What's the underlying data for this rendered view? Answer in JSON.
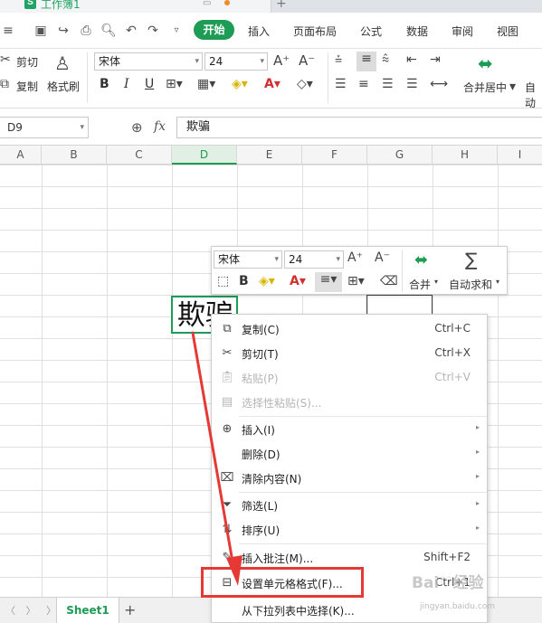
{
  "title_tabs": {
    "doc_name": "工作簿1",
    "app_icon": "S",
    "new_tab": "+"
  },
  "menu": {
    "start": "开始",
    "items": [
      "插入",
      "页面布局",
      "公式",
      "数据",
      "审阅",
      "视图"
    ]
  },
  "ribbon": {
    "cut": "剪切",
    "copy": "复制",
    "format_painter": "格式刷",
    "font_name": "宋体",
    "font_size": "24",
    "bold": "B",
    "italic": "I",
    "underline": "U",
    "merge_center": "合并居中",
    "auto_wrap": "自动"
  },
  "formula_bar": {
    "name_box": "D9",
    "fx": "fx",
    "content": "欺骗"
  },
  "columns": [
    "A",
    "B",
    "C",
    "D",
    "E",
    "F",
    "G",
    "H",
    "I"
  ],
  "selected_column": "D",
  "active_cell_value": "欺骗",
  "mini_toolbar": {
    "font_name": "宋体",
    "font_size": "24",
    "bold": "B",
    "merge": "合并",
    "autosum": "自动求和",
    "sigma": "∑"
  },
  "context_menu": [
    {
      "icon": "copy-icon",
      "label": "复制(C)",
      "shortcut": "Ctrl+C",
      "enabled": true
    },
    {
      "icon": "scissors-icon",
      "label": "剪切(T)",
      "shortcut": "Ctrl+X",
      "enabled": true
    },
    {
      "icon": "paste-icon",
      "label": "粘贴(P)",
      "shortcut": "Ctrl+V",
      "enabled": false
    },
    {
      "icon": "paste-special-icon",
      "label": "选择性粘贴(S)...",
      "shortcut": "",
      "enabled": false
    },
    {
      "icon": "insert-icon",
      "label": "插入(I)",
      "shortcut": "",
      "enabled": true,
      "submenu": true
    },
    {
      "icon": "",
      "label": "删除(D)",
      "shortcut": "",
      "enabled": true,
      "submenu": true
    },
    {
      "icon": "eraser-icon",
      "label": "清除内容(N)",
      "shortcut": "",
      "enabled": true,
      "submenu": true
    },
    {
      "icon": "filter-icon",
      "label": "筛选(L)",
      "shortcut": "",
      "enabled": true,
      "submenu": true
    },
    {
      "icon": "sort-icon",
      "label": "排序(U)",
      "shortcut": "",
      "enabled": true,
      "submenu": true
    },
    {
      "icon": "comment-icon",
      "label": "插入批注(M)...",
      "shortcut": "Shift+F2",
      "enabled": true
    },
    {
      "icon": "format-cells-icon",
      "label": "设置单元格格式(F)...",
      "shortcut": "Ctrl+1",
      "enabled": true
    },
    {
      "icon": "",
      "label": "从下拉列表中选择(K)...",
      "shortcut": "",
      "enabled": true
    }
  ],
  "sheet_tab": "Sheet1",
  "annotation_color": "#e53935",
  "accent_color": "#1e9b54"
}
